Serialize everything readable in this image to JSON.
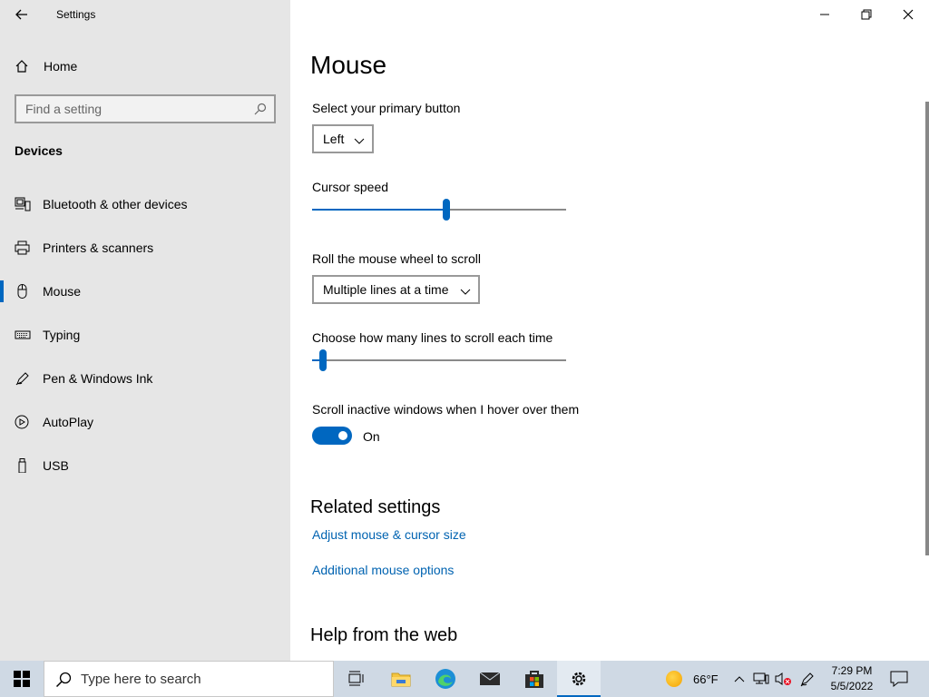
{
  "window": {
    "title": "Settings",
    "back_icon": "back-arrow-icon",
    "controls": [
      "minimize-icon",
      "restore-icon",
      "close-icon"
    ]
  },
  "sidebar": {
    "home_label": "Home",
    "search_placeholder": "Find a setting",
    "section": "Devices",
    "items": [
      {
        "label": "Bluetooth & other devices",
        "icon": "bluetooth-devices-icon"
      },
      {
        "label": "Printers & scanners",
        "icon": "printer-icon"
      },
      {
        "label": "Mouse",
        "icon": "mouse-icon",
        "active": true
      },
      {
        "label": "Typing",
        "icon": "keyboard-icon"
      },
      {
        "label": "Pen & Windows Ink",
        "icon": "pen-icon"
      },
      {
        "label": "AutoPlay",
        "icon": "autoplay-icon"
      },
      {
        "label": "USB",
        "icon": "usb-icon"
      }
    ]
  },
  "main": {
    "title": "Mouse",
    "primary_button": {
      "label": "Select your primary button",
      "value": "Left"
    },
    "cursor_speed": {
      "label": "Cursor speed",
      "level": 0.53
    },
    "wheel_scroll": {
      "label": "Roll the mouse wheel to scroll",
      "value": "Multiple lines at a time"
    },
    "lines_to_scroll": {
      "label": "Choose how many lines to scroll each time",
      "level": 0.03
    },
    "scroll_inactive": {
      "label": "Scroll inactive windows when I hover over them",
      "state": "On"
    },
    "related": {
      "heading": "Related settings",
      "links": [
        "Adjust mouse & cursor size",
        "Additional mouse options"
      ]
    },
    "help_heading": "Help from the web"
  },
  "taskbar": {
    "search_placeholder": "Type here to search",
    "weather": "66°F",
    "time": "7:29 PM",
    "date": "5/5/2022"
  },
  "colors": {
    "accent": "#0067c0",
    "link": "#0063b1",
    "sidebar_bg": "#e6e6e6",
    "taskbar_bg": "#cfd9e4"
  }
}
